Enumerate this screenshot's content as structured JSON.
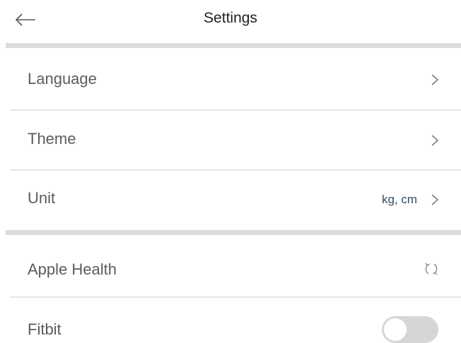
{
  "header": {
    "title": "Settings",
    "back_icon": "arrow-left-icon"
  },
  "sections": [
    {
      "items": [
        {
          "label": "Language",
          "icon": "chevron-right-icon"
        },
        {
          "label": "Theme",
          "icon": "chevron-right-icon"
        },
        {
          "label": "Unit",
          "value": "kg, cm",
          "icon": "chevron-right-icon"
        }
      ]
    },
    {
      "items": [
        {
          "label": "Apple Health",
          "icon": "sync-icon"
        },
        {
          "label": "Fitbit",
          "toggle": {
            "on": false
          }
        }
      ]
    }
  ],
  "colors": {
    "value_text": "#2c4f66",
    "divider_thick": "#dcdcdc",
    "divider_thin": "#e6e6e6",
    "toggle_off": "#d6d6d6"
  }
}
